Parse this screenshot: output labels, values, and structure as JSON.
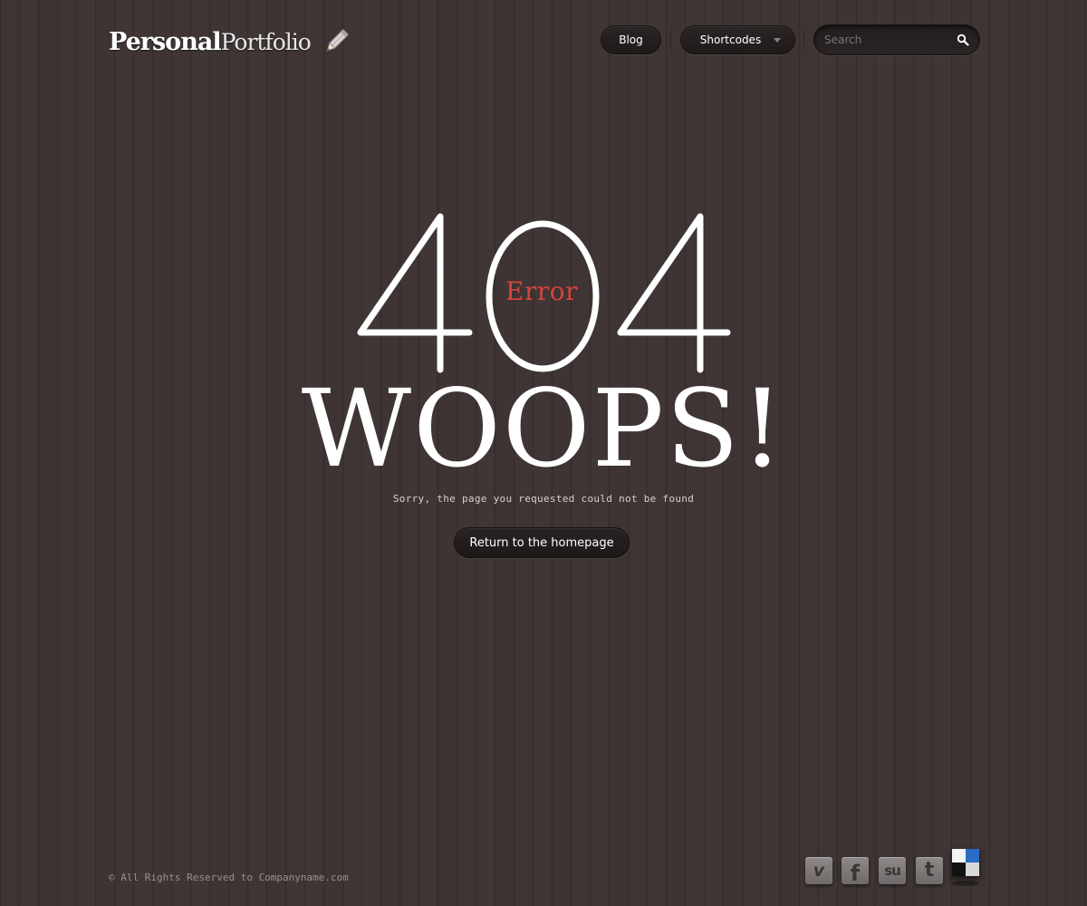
{
  "header": {
    "logo_bold": "Personal",
    "logo_light": "Portfolio",
    "logo_icon": "pencil-icon",
    "nav": {
      "blog_label": "Blog",
      "shortcodes_label": "Shortcodes"
    },
    "search": {
      "placeholder": "Search",
      "icon": "search-icon"
    }
  },
  "main": {
    "code": "404",
    "error_label": "Error",
    "headline": "WOOPS!",
    "message": "Sorry, the page you requested could not be found",
    "home_button_label": "Return to the homepage"
  },
  "footer": {
    "copyright": "© All Rights Reserved to Companyname.com",
    "social": [
      {
        "name": "vimeo-icon",
        "glyph": "v"
      },
      {
        "name": "facebook-icon",
        "glyph": "f"
      },
      {
        "name": "stumbleupon-icon",
        "glyph": "su"
      },
      {
        "name": "twitter-icon",
        "glyph": "t"
      },
      {
        "name": "delicious-icon",
        "glyph": ""
      }
    ]
  },
  "colors": {
    "background": "#3b3231",
    "error_red": "#d7443a",
    "text_white": "#ffffff",
    "button_dark": "#211b1b"
  }
}
